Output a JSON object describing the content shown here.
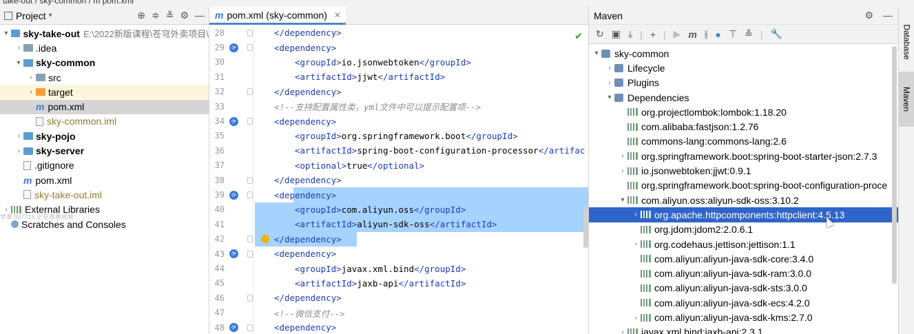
{
  "breadcrumb": {
    "text": "take-out / sky-common / m pom.xml"
  },
  "project_panel": {
    "title": "Project",
    "items": [
      {
        "label": "sky-take-out",
        "path": "E:\\2022新版课程\\苍穹外卖项目\\",
        "arrow": "▾",
        "icon": "module-folder-icon",
        "bold": true,
        "indent": 0
      },
      {
        "label": ".idea",
        "arrow": "›",
        "icon": "folder-icon",
        "indent": 1
      },
      {
        "label": "sky-common",
        "arrow": "▾",
        "icon": "module-folder-icon",
        "bold": true,
        "indent": 1
      },
      {
        "label": "src",
        "arrow": "›",
        "icon": "folder-icon",
        "indent": 2
      },
      {
        "label": "target",
        "arrow": "›",
        "icon": "excluded-folder-icon",
        "indent": 2,
        "target": true
      },
      {
        "label": "pom.xml",
        "arrow": "",
        "icon": "maven-icon",
        "indent": 2,
        "selected": true
      },
      {
        "label": "sky-common.iml",
        "arrow": "",
        "icon": "iml-file-icon",
        "indent": 2,
        "olive": true
      },
      {
        "label": "sky-pojo",
        "arrow": "›",
        "icon": "module-folder-icon",
        "bold": true,
        "indent": 1
      },
      {
        "label": "sky-server",
        "arrow": "›",
        "icon": "module-folder-icon",
        "bold": true,
        "indent": 1
      },
      {
        "label": ".gitignore",
        "arrow": "",
        "icon": "file-icon",
        "indent": 1
      },
      {
        "label": "pom.xml",
        "arrow": "",
        "icon": "maven-icon",
        "indent": 1
      },
      {
        "label": "sky-take-out.iml",
        "arrow": "",
        "icon": "iml-file-icon",
        "indent": 1,
        "olive": true
      },
      {
        "label": "External Libraries",
        "arrow": "›",
        "icon": "library-icon",
        "indent": 0
      },
      {
        "label": "Scratches and Consoles",
        "arrow": "",
        "icon": "scratches-icon",
        "indent": 0
      }
    ],
    "watermark": "学者 887715 正在观看视频"
  },
  "editor": {
    "tab_label": "pom.xml (sky-common)",
    "lines": [
      {
        "n": "28",
        "ind": 1,
        "parts": [
          [
            "tag",
            "</dependency>"
          ]
        ]
      },
      {
        "n": "29",
        "ind": 1,
        "gicon": true,
        "parts": [
          [
            "tag",
            "<dependency>"
          ]
        ]
      },
      {
        "n": "30",
        "ind": 2,
        "parts": [
          [
            "tag",
            "<groupId>"
          ],
          [
            "txt",
            "io.jsonwebtoken"
          ],
          [
            "tag",
            "</groupId>"
          ]
        ]
      },
      {
        "n": "31",
        "ind": 2,
        "parts": [
          [
            "tag",
            "<artifactId>"
          ],
          [
            "txt",
            "jjwt"
          ],
          [
            "tag",
            "</artifactId>"
          ]
        ]
      },
      {
        "n": "32",
        "ind": 1,
        "parts": [
          [
            "tag",
            "</dependency>"
          ]
        ]
      },
      {
        "n": "33",
        "ind": 1,
        "parts": [
          [
            "cmt",
            "<!--支持配置属性类，yml文件中可以提示配置项-->"
          ]
        ]
      },
      {
        "n": "34",
        "ind": 1,
        "gicon": true,
        "parts": [
          [
            "tag",
            "<dependency>"
          ]
        ]
      },
      {
        "n": "35",
        "ind": 2,
        "parts": [
          [
            "tag",
            "<groupId>"
          ],
          [
            "txt",
            "org.springframework.boot"
          ],
          [
            "tag",
            "</groupId>"
          ]
        ]
      },
      {
        "n": "36",
        "ind": 2,
        "parts": [
          [
            "tag",
            "<artifactId>"
          ],
          [
            "txt",
            "spring-boot-configuration-processor"
          ],
          [
            "tag",
            "</artifac"
          ]
        ]
      },
      {
        "n": "37",
        "ind": 2,
        "parts": [
          [
            "tag",
            "<optional>"
          ],
          [
            "txt",
            "true"
          ],
          [
            "tag",
            "</optional>"
          ]
        ]
      },
      {
        "n": "38",
        "ind": 1,
        "parts": [
          [
            "tag",
            "</dependency>"
          ]
        ]
      },
      {
        "n": "39",
        "ind": 1,
        "gicon": true,
        "parts": [
          [
            "tag",
            "<dependency>"
          ]
        ]
      },
      {
        "n": "40",
        "ind": 2,
        "parts": [
          [
            "tag",
            "<groupId>"
          ],
          [
            "txt",
            "com.aliyun.oss"
          ],
          [
            "tag",
            "</groupId>"
          ]
        ]
      },
      {
        "n": "41",
        "ind": 2,
        "parts": [
          [
            "tag",
            "<artifactId>"
          ],
          [
            "txt",
            "aliyun-sdk-oss"
          ],
          [
            "tag",
            "</artifactId>"
          ]
        ]
      },
      {
        "n": "42",
        "ind": 1,
        "bulb": true,
        "parts": [
          [
            "tag",
            "</dependency>"
          ]
        ]
      },
      {
        "n": "43",
        "ind": 1,
        "gicon": true,
        "parts": [
          [
            "tag",
            "<dependency>"
          ]
        ]
      },
      {
        "n": "44",
        "ind": 2,
        "parts": [
          [
            "tag",
            "<groupId>"
          ],
          [
            "txt",
            "javax.xml.bind"
          ],
          [
            "tag",
            "</groupId>"
          ]
        ]
      },
      {
        "n": "45",
        "ind": 2,
        "parts": [
          [
            "tag",
            "<artifactId>"
          ],
          [
            "txt",
            "jaxb-api"
          ],
          [
            "tag",
            "</artifactId>"
          ]
        ]
      },
      {
        "n": "46",
        "ind": 1,
        "parts": [
          [
            "tag",
            "</dependency>"
          ]
        ]
      },
      {
        "n": "47",
        "ind": 1,
        "parts": [
          [
            "cmt",
            "<!--微信支付-->"
          ]
        ]
      },
      {
        "n": "48",
        "ind": 1,
        "gicon": true,
        "parts": [
          [
            "tag",
            "<dependency>"
          ]
        ]
      }
    ],
    "inspection_status": "✔"
  },
  "maven": {
    "title": "Maven",
    "items": [
      {
        "label": "sky-common",
        "arrow": "▾",
        "icon": "maven-module-icon",
        "indent": 0
      },
      {
        "label": "Lifecycle",
        "arrow": "›",
        "icon": "lifecycle-icon",
        "indent": 1
      },
      {
        "label": "Plugins",
        "arrow": "›",
        "icon": "plugins-icon",
        "indent": 1
      },
      {
        "label": "Dependencies",
        "arrow": "▾",
        "icon": "dependencies-icon",
        "indent": 1
      },
      {
        "label": "org.projectlombok:lombok:1.18.20",
        "arrow": "",
        "icon": "library-icon",
        "indent": 2
      },
      {
        "label": "com.alibaba:fastjson:1.2.76",
        "arrow": "",
        "icon": "library-icon",
        "indent": 2
      },
      {
        "label": "commons-lang:commons-lang:2.6",
        "arrow": "",
        "icon": "library-icon",
        "indent": 2
      },
      {
        "label": "org.springframework.boot:spring-boot-starter-json:2.7.3",
        "arrow": "›",
        "icon": "library-icon",
        "indent": 2
      },
      {
        "label": "io.jsonwebtoken:jjwt:0.9.1",
        "arrow": "›",
        "icon": "library-icon",
        "indent": 2
      },
      {
        "label": "org.springframework.boot:spring-boot-configuration-proce",
        "arrow": "",
        "icon": "library-icon",
        "indent": 2
      },
      {
        "label": "com.aliyun.oss:aliyun-sdk-oss:3.10.2",
        "arrow": "▾",
        "icon": "library-icon",
        "indent": 2
      },
      {
        "label": "org.apache.httpcomponents:httpclient:4.5.13",
        "arrow": "›",
        "icon": "library-icon",
        "indent": 3,
        "selected": true
      },
      {
        "label": "org.jdom:jdom2:2.0.6.1",
        "arrow": "",
        "icon": "library-icon",
        "indent": 3
      },
      {
        "label": "org.codehaus.jettison:jettison:1.1",
        "arrow": "›",
        "icon": "library-icon",
        "indent": 3
      },
      {
        "label": "com.aliyun:aliyun-java-sdk-core:3.4.0",
        "arrow": "",
        "icon": "library-icon",
        "indent": 3
      },
      {
        "label": "com.aliyun:aliyun-java-sdk-ram:3.0.0",
        "arrow": "",
        "icon": "library-icon",
        "indent": 3
      },
      {
        "label": "com.aliyun:aliyun-java-sdk-sts:3.0.0",
        "arrow": "",
        "icon": "library-icon",
        "indent": 3
      },
      {
        "label": "com.aliyun:aliyun-java-sdk-ecs:4.2.0",
        "arrow": "",
        "icon": "library-icon",
        "indent": 3
      },
      {
        "label": "com.aliyun:aliyun-java-sdk-kms:2.7.0",
        "arrow": "›",
        "icon": "library-icon",
        "indent": 3
      },
      {
        "label": "javax.xml.bind:jaxb-api:2.3.1",
        "arrow": "›",
        "icon": "library-icon",
        "indent": 2
      }
    ]
  },
  "side_stripe": {
    "database_label": "Database",
    "maven_label": "Maven"
  },
  "colors": {
    "selection": "#2f65ca",
    "code_highlight": "#a6d2ff",
    "xml_tag": "#1d3bb3",
    "comment": "#8c8c8c"
  }
}
